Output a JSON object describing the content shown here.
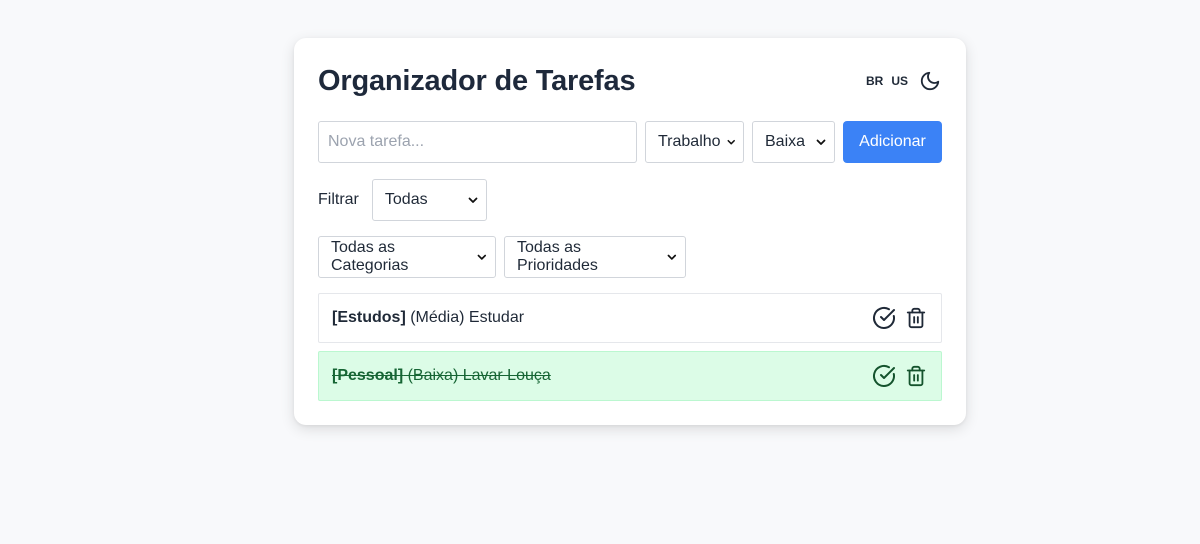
{
  "app": {
    "title": "Organizador de Tarefas",
    "languages": [
      "BR",
      "US"
    ],
    "theme_icon": "moon-icon"
  },
  "new_task": {
    "placeholder": "Nova tarefa...",
    "category_selected": "Trabalho",
    "priority_selected": "Baixa",
    "add_label": "Adicionar"
  },
  "filter": {
    "label": "Filtrar",
    "status_selected": "Todas",
    "category_selected": "Todas as Categorias",
    "priority_selected": "Todas as Prioridades"
  },
  "tasks": [
    {
      "category": "[Estudos]",
      "rest": " (Média) Estudar",
      "completed": false
    },
    {
      "category": "[Pessoal]",
      "rest": " (Baixa) Lavar Louça",
      "completed": true
    }
  ],
  "colors": {
    "accent": "#3b82f6",
    "done_bg": "#dcfce7",
    "done_text": "#166534",
    "title": "#1e293b"
  },
  "icons": {
    "complete": "check-circle-icon",
    "delete": "trash-icon",
    "dropdown": "chevron-down-icon"
  }
}
